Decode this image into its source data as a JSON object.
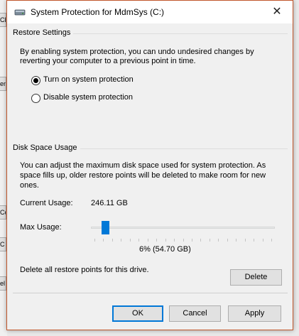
{
  "window": {
    "title": "System Protection for MdmSys (C:)",
    "close_glyph": "✕",
    "accent_color": "#0078d7",
    "border_color": "#c1562b"
  },
  "restore_settings": {
    "header": "Restore Settings",
    "description_line1": "By enabling system protection, you can undo undesired changes by",
    "description_line2": "reverting your computer to a previous point in time.",
    "options": [
      {
        "label": "Turn on system protection",
        "selected": true
      },
      {
        "label": "Disable system protection",
        "selected": false
      }
    ]
  },
  "disk_space": {
    "header": "Disk Space Usage",
    "description_line1": "You can adjust the maximum disk space used for system protection. As",
    "description_line2": "space fills up, older restore points will be deleted to make room for new",
    "description_line3": "ones.",
    "current_usage_label": "Current Usage:",
    "current_usage_value": "246.11 GB",
    "max_usage_label": "Max Usage:",
    "max_usage_percent": 6,
    "max_usage_readout": "6% (54.70 GB)",
    "delete_text": "Delete all restore points for this drive.",
    "delete_button": "Delete"
  },
  "footer": {
    "ok": "OK",
    "cancel": "Cancel",
    "apply": "Apply"
  },
  "background": {
    "tab_fragments": [
      "Ch",
      "em",
      "Co",
      "C",
      "el"
    ]
  }
}
